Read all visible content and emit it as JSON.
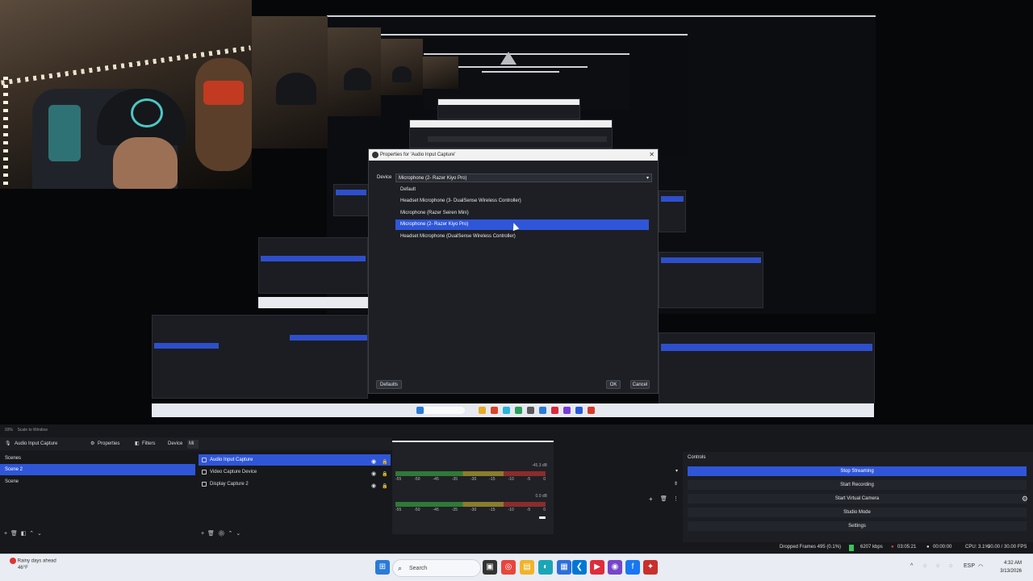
{
  "dialog": {
    "title": "Properties for 'Audio Input Capture'",
    "device_label": "Device",
    "selected_device": "Microphone (2- Razer Kiyo Pro)",
    "options": [
      "Default",
      "Headset Microphone (3- DualSense Wireless Controller)",
      "Microphone (Razer Seiren Mini)",
      "Microphone (2- Razer Kiyo Pro)",
      "Headset Microphone (DualSense Wireless Controller)"
    ],
    "selected_index": 3,
    "defaults_label": "Defaults",
    "ok_label": "OK",
    "cancel_label": "Cancel"
  },
  "preview_zoom": "93%",
  "preview_scale": "Scale to Window",
  "source_toolbar": {
    "current_source": "Audio Input Capture",
    "properties": "Properties",
    "filters": "Filters",
    "device": "Device",
    "device_value": "Mi"
  },
  "scenes": {
    "title": "Scenes",
    "items": [
      "Scene 2",
      "Scene"
    ],
    "selected_index": 0
  },
  "sources": {
    "items": [
      "Audio Input Capture",
      "Video Capture Device",
      "Display Capture 2"
    ],
    "selected_index": 0
  },
  "mixer": {
    "db_top": "-45.3 dB",
    "db_bottom": "0.0 dB",
    "ticks": [
      "-60",
      "-55",
      "-50",
      "-45",
      "-40",
      "-35",
      "-30",
      "-25",
      "-20",
      "-15",
      "-10",
      "-5",
      "0"
    ],
    "ticks_short": [
      "-55",
      "-50",
      "-45",
      "-35",
      "-30",
      "-15",
      "-10",
      "-5",
      "0"
    ]
  },
  "controls": {
    "title": "Controls",
    "buttons": [
      {
        "label": "Stop Streaming",
        "active": true
      },
      {
        "label": "Start Recording",
        "active": false
      },
      {
        "label": "Start Virtual Camera",
        "active": false
      },
      {
        "label": "Studio Mode",
        "active": false
      },
      {
        "label": "Settings",
        "active": false
      }
    ]
  },
  "status": {
    "dropped_frames": "Dropped Frames 495 (0.1%)",
    "bitrate": "6207 kbps",
    "live_time": "03:05:21",
    "rec_time": "00:00:00",
    "cpu": "CPU: 3.1%",
    "fps": "30.00 / 30.00 FPS"
  },
  "taskbar": {
    "weather_line1": "Rainy days ahead",
    "weather_line2": "46°F",
    "search_placeholder": "Search",
    "time": "4:32 AM",
    "date": "3/13/2026",
    "lang": "ESP"
  },
  "colors": {
    "accent": "#2f56d8",
    "panel": "#1c1e23",
    "background": "#17181c"
  }
}
